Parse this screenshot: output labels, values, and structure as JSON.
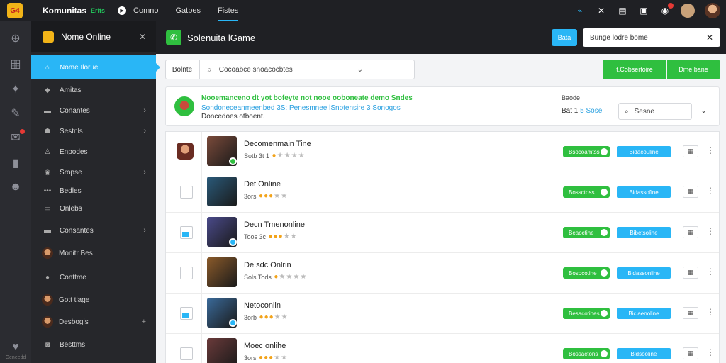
{
  "topbar": {
    "logo_text": "G4",
    "brand": "Komunitas",
    "brand_sub": "Erits",
    "nav": [
      "Comno",
      "Gatbes",
      "Fistes"
    ],
    "active_nav": 2
  },
  "rail": {
    "footer": "Geneedd"
  },
  "sidebar": {
    "header": "Nome Online",
    "items": [
      {
        "label": "Nome Ilorue",
        "icon": "home-icon",
        "chevron": false
      },
      {
        "label": "Amitas",
        "icon": "shield-icon",
        "chevron": false
      },
      {
        "label": "Conantes",
        "icon": "folder-icon",
        "chevron": true
      },
      {
        "label": "Sestnls",
        "icon": "user-icon",
        "chevron": true
      },
      {
        "label": "Enpodes",
        "icon": "user-plus-icon",
        "chevron": false
      },
      {
        "label": "Sropse",
        "icon": "globe-icon",
        "chevron": true
      },
      {
        "label": "Bedles",
        "icon": "dots-icon",
        "chevron": false
      },
      {
        "label": "Onlebs",
        "icon": "list-icon",
        "chevron": false
      },
      {
        "label": "Consantes",
        "icon": "folder-icon",
        "chevron": true
      },
      {
        "label": "Monitr Bes",
        "icon": "avatar",
        "chevron": false
      },
      {
        "label": "Conttme",
        "icon": "chat-icon",
        "chevron": false
      },
      {
        "label": "Gott tlage",
        "icon": "avatar",
        "chevron": false
      },
      {
        "label": "Desbogis",
        "icon": "avatar",
        "chevron": false,
        "plus": true
      },
      {
        "label": "Besttms",
        "icon": "camera-icon",
        "chevron": false
      }
    ]
  },
  "main": {
    "title": "Solenuita lGame",
    "search_btn": "Bata",
    "header_search": "Bunge lodre bome",
    "filter_label": "Bolnte",
    "filter_placeholder": "Cocoabce snoacocbtes",
    "green_btn_1": "t.Cobsertoire",
    "green_btn_2": "Dme bane"
  },
  "banner": {
    "line1": "Nooemanceno dt yot bofeyte not nooe ooboneate demo Sndes",
    "line2": "Sondoneceanmeenbed 3S: Penesmnee lSnotensire 3 Sonogos",
    "line3": "Doncedoes otboent.",
    "stat_label": "Baode",
    "stat_value": "Bat 1",
    "stat_accent": "5 Sose",
    "search": "Sesne"
  },
  "rows": [
    {
      "name": "Decomenmain Tine",
      "meta": "Sotb 3t 1",
      "stars": 1,
      "green": "Bsocoamtss",
      "blue": "Bidacouline",
      "thumb": "#7a4a3a",
      "badge": "#2fbf3f",
      "checkbox": "avatar"
    },
    {
      "name": "Det Online",
      "meta": "3ors",
      "stars": 3,
      "green": "Bossctoss",
      "blue": "Bidassofine",
      "thumb": "#2a5a7a",
      "badge": "",
      "checkbox": "empty"
    },
    {
      "name": "Decn Tmenonline",
      "meta": "Toos 3c",
      "stars": 3,
      "green": "Beaoctine",
      "blue": "Bibetsoline",
      "thumb": "#4a4a8a",
      "badge": "#29b6f6",
      "checkbox": "half"
    },
    {
      "name": "De sdc Onlrin",
      "meta": "Sols Tods",
      "stars": 1,
      "green": "Bosocotine",
      "blue": "Bldassonline",
      "thumb": "#8a5a2a",
      "badge": "",
      "checkbox": "empty"
    },
    {
      "name": "Netoconlin",
      "meta": "3orb",
      "stars": 3,
      "green": "Besacotines",
      "blue": "Biclaenoline",
      "thumb": "#3a6a9a",
      "badge": "#29b6f6",
      "checkbox": "half"
    },
    {
      "name": "Moec onlihe",
      "meta": "3ors",
      "stars": 3,
      "green": "Bossactons",
      "blue": "Bldsooline",
      "thumb": "#6a3a3a",
      "badge": "",
      "checkbox": "empty"
    }
  ]
}
